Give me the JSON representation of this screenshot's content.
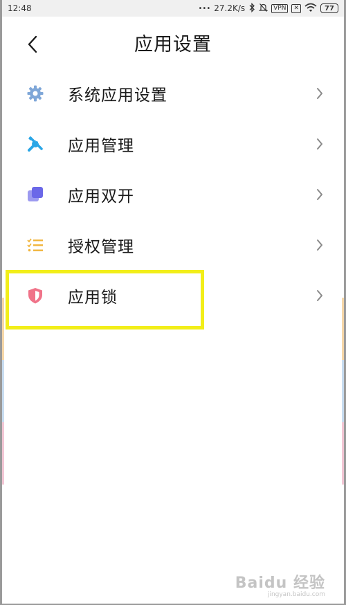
{
  "status_bar": {
    "time": "12:48",
    "dots": "•••",
    "net_speed": "27.2K/s",
    "vpn": "VPN",
    "sim": "✕",
    "battery": "77"
  },
  "header": {
    "title": "应用设置"
  },
  "menu": {
    "items": [
      {
        "label": "系统应用设置",
        "icon": "gear-icon",
        "color": "#7fa7d8"
      },
      {
        "label": "应用管理",
        "icon": "tools-icon",
        "color": "#2aa6e6"
      },
      {
        "label": "应用双开",
        "icon": "dual-app-icon",
        "color": "#6b68e8"
      },
      {
        "label": "授权管理",
        "icon": "checklist-icon",
        "color": "#f1b53d"
      },
      {
        "label": "应用锁",
        "icon": "shield-icon",
        "color": "#f07389"
      }
    ]
  },
  "watermark": {
    "main": "Baidu 经验",
    "sub": "jingyan.baidu.com"
  }
}
